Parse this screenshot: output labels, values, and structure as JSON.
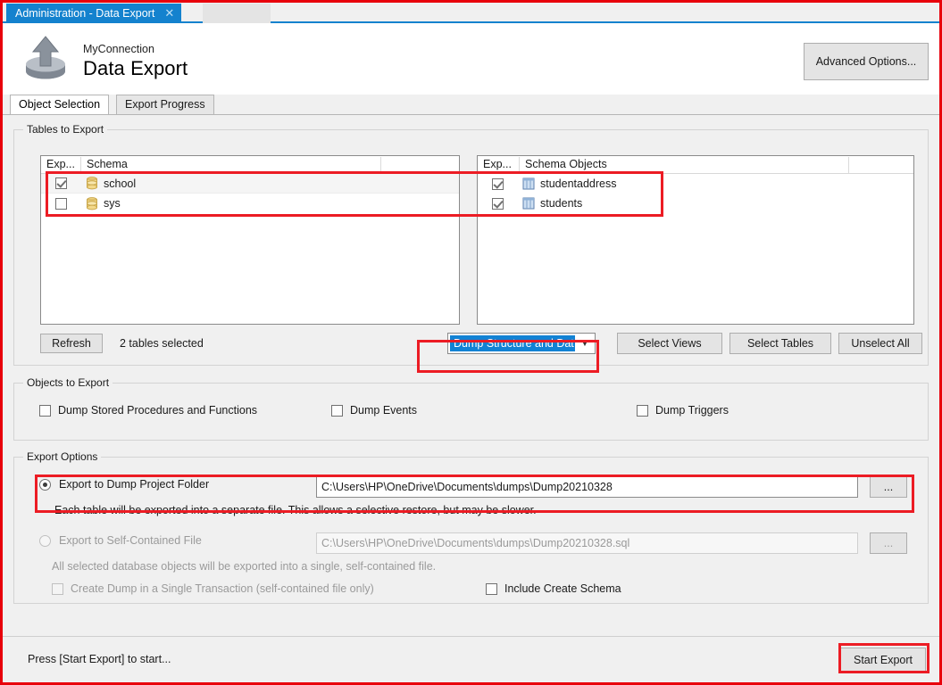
{
  "window": {
    "tab_title": "Administration - Data Export",
    "tab_close_icon": "close-icon"
  },
  "header": {
    "connection": "MyConnection",
    "title": "Data Export",
    "icon": "data-export-upload-icon",
    "advanced_options_label": "Advanced Options..."
  },
  "subtabs": [
    {
      "label": "Object Selection",
      "active": true
    },
    {
      "label": "Export Progress",
      "active": false
    }
  ],
  "tables_group": {
    "legend": "Tables to Export",
    "schema_list": {
      "columns": [
        "Exp...",
        "Schema"
      ],
      "rows": [
        {
          "checked": true,
          "icon": "database-icon",
          "name": "school"
        },
        {
          "checked": false,
          "icon": "database-icon",
          "name": "sys"
        }
      ]
    },
    "objects_list": {
      "columns": [
        "Exp...",
        "Schema Objects"
      ],
      "rows": [
        {
          "checked": true,
          "icon": "table-icon",
          "name": "studentaddress"
        },
        {
          "checked": true,
          "icon": "table-icon",
          "name": "students"
        }
      ]
    },
    "refresh_label": "Refresh",
    "selection_status": "2 tables selected",
    "dump_select_value": "Dump Structure and Dat",
    "dump_select_arrow": "chevron-down-icon",
    "select_views_label": "Select Views",
    "select_tables_label": "Select Tables",
    "unselect_all_label": "Unselect All"
  },
  "objects_group": {
    "legend": "Objects to Export",
    "options": [
      {
        "label": "Dump Stored Procedures and Functions",
        "checked": false,
        "enabled": true
      },
      {
        "label": "Dump Events",
        "checked": false,
        "enabled": true
      },
      {
        "label": "Dump Triggers",
        "checked": false,
        "enabled": true
      }
    ]
  },
  "export_group": {
    "legend": "Export Options",
    "folder_option": {
      "label": "Export to Dump Project Folder",
      "selected": true,
      "path": "C:\\Users\\HP\\OneDrive\\Documents\\dumps\\Dump20210328",
      "browse_label": "...",
      "hint": "Each table will be exported into a separate file. This allows a selective restore, but may be slower."
    },
    "file_option": {
      "label": "Export to Self-Contained File",
      "selected": false,
      "path": "C:\\Users\\HP\\OneDrive\\Documents\\dumps\\Dump20210328.sql",
      "browse_label": "...",
      "hint": "All selected database objects will be exported into a single, self-contained file."
    },
    "single_transaction": {
      "label": "Create Dump in a Single Transaction (self-contained file only)",
      "checked": false,
      "enabled": false
    },
    "include_create_schema": {
      "label": "Include Create Schema",
      "checked": false,
      "enabled": true
    }
  },
  "statusbar": {
    "message": "Press [Start Export] to start...",
    "start_export_label": "Start Export"
  },
  "colors": {
    "tab_blue": "#1482ce",
    "selection_blue": "#1282d4",
    "annotation_red": "#ec1c24",
    "panel_gray": "#f0f0f0"
  }
}
